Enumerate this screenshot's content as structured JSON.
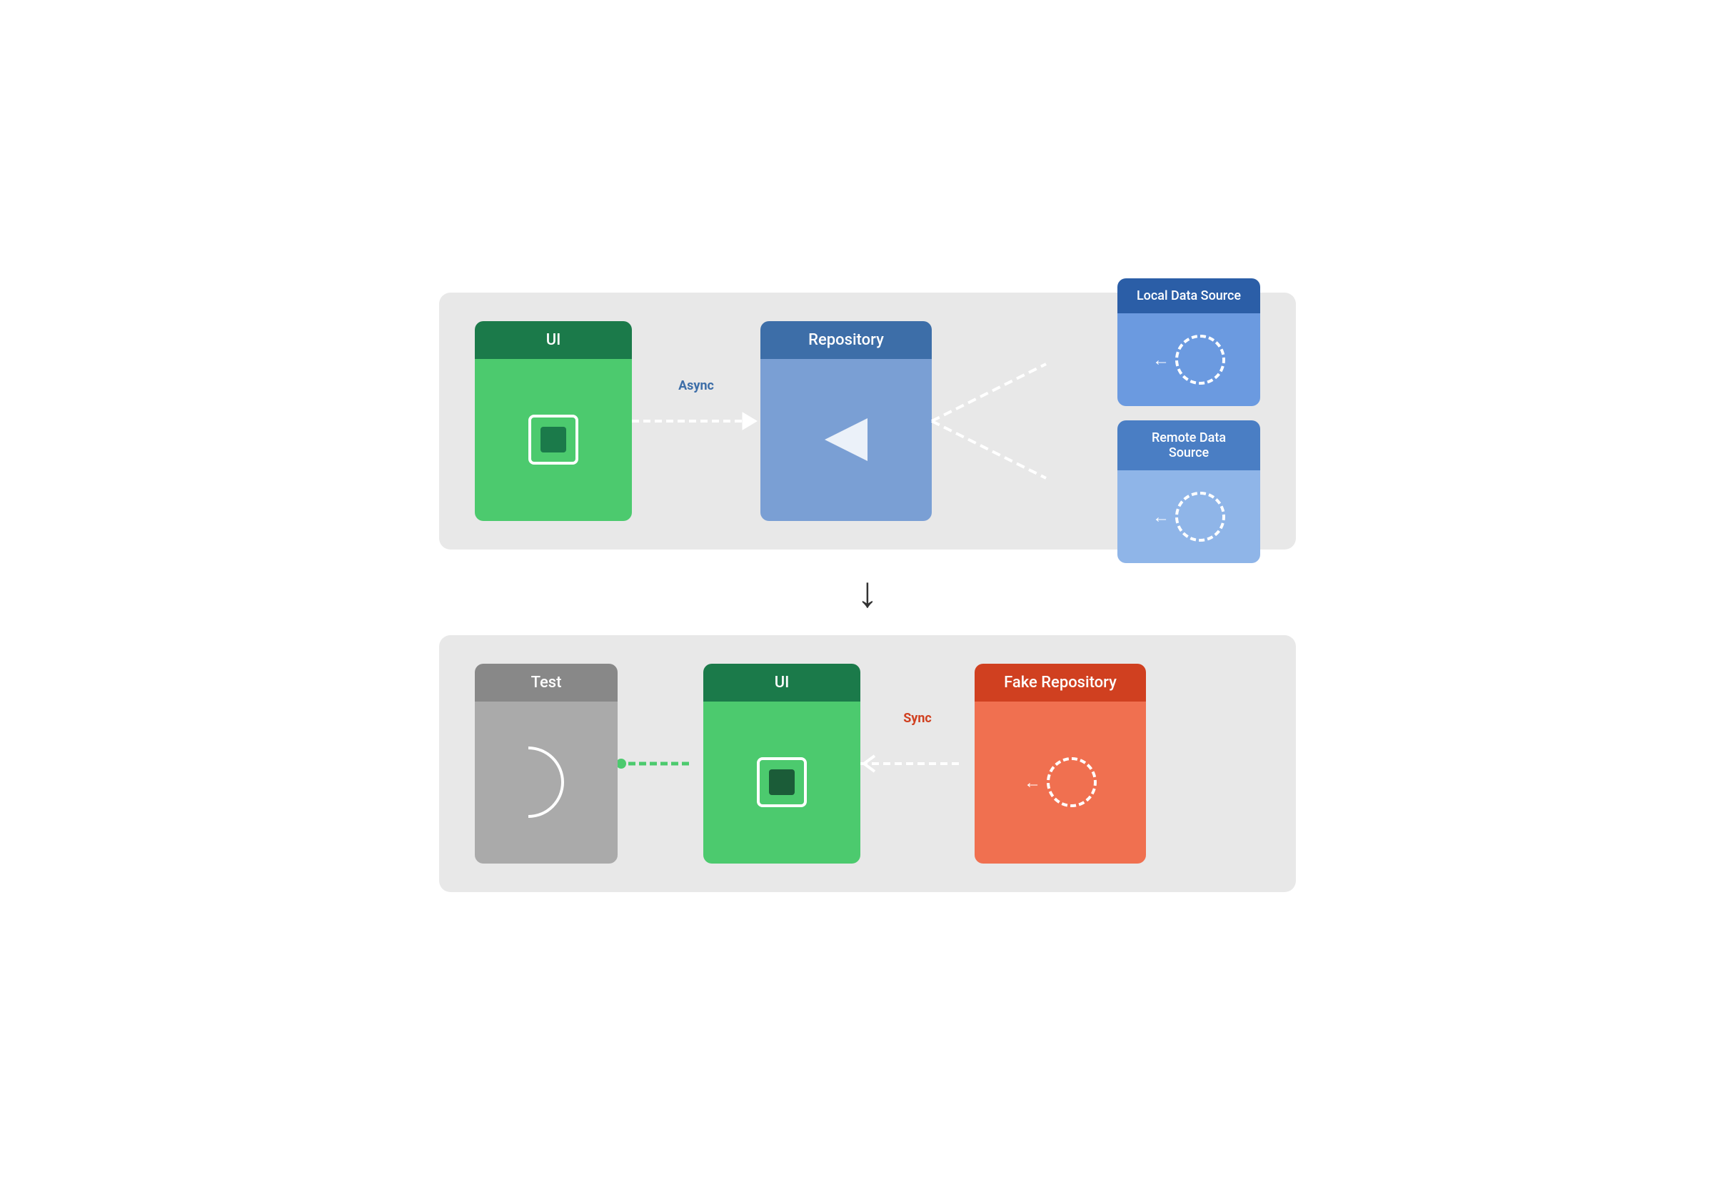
{
  "diagrams": {
    "top": {
      "ui_label": "UI",
      "repo_label": "Repository",
      "local_source_label": "Local Data Source",
      "remote_source_label": "Remote Data Source",
      "async_label": "Async"
    },
    "bottom": {
      "test_label": "Test",
      "ui_label": "UI",
      "fake_repo_label": "Fake Repository",
      "sync_label": "Sync"
    }
  },
  "arrow_down": "↓"
}
